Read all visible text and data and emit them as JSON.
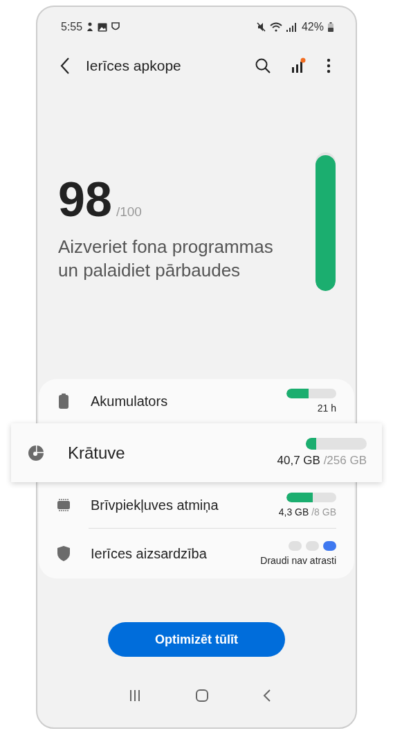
{
  "status_bar": {
    "time": "5:55",
    "battery": "42%"
  },
  "header": {
    "title": "Ierīces apkope",
    "notification_dot": true
  },
  "score": {
    "value": "98",
    "max": "/100",
    "message": "Aizveriet fona programmas un palaidiet pārbaudes",
    "level": 0.98
  },
  "items": [
    {
      "kind": "bar",
      "label": "Akumulators",
      "level": 0.45,
      "value": "21 h",
      "highlighted": false
    },
    {
      "kind": "bar",
      "label": "Krātuve",
      "level": 0.17,
      "value": "40,7 GB",
      "total": "/256 GB",
      "highlighted": true
    },
    {
      "kind": "bar",
      "label": "Brīvpiekļuves atmiņa",
      "level": 0.53,
      "value": "4,3 GB",
      "total": "/8 GB",
      "highlighted": false
    },
    {
      "kind": "dots",
      "label": "Ierīces aizsardzība",
      "dots": [
        {
          "color": "#e0e0e0"
        },
        {
          "color": "#e0e0e0"
        },
        {
          "color": "#3e78f0"
        }
      ],
      "value": "Draudi nav atrasti",
      "highlighted": false
    }
  ],
  "button": "Optimizēt tūlīt"
}
